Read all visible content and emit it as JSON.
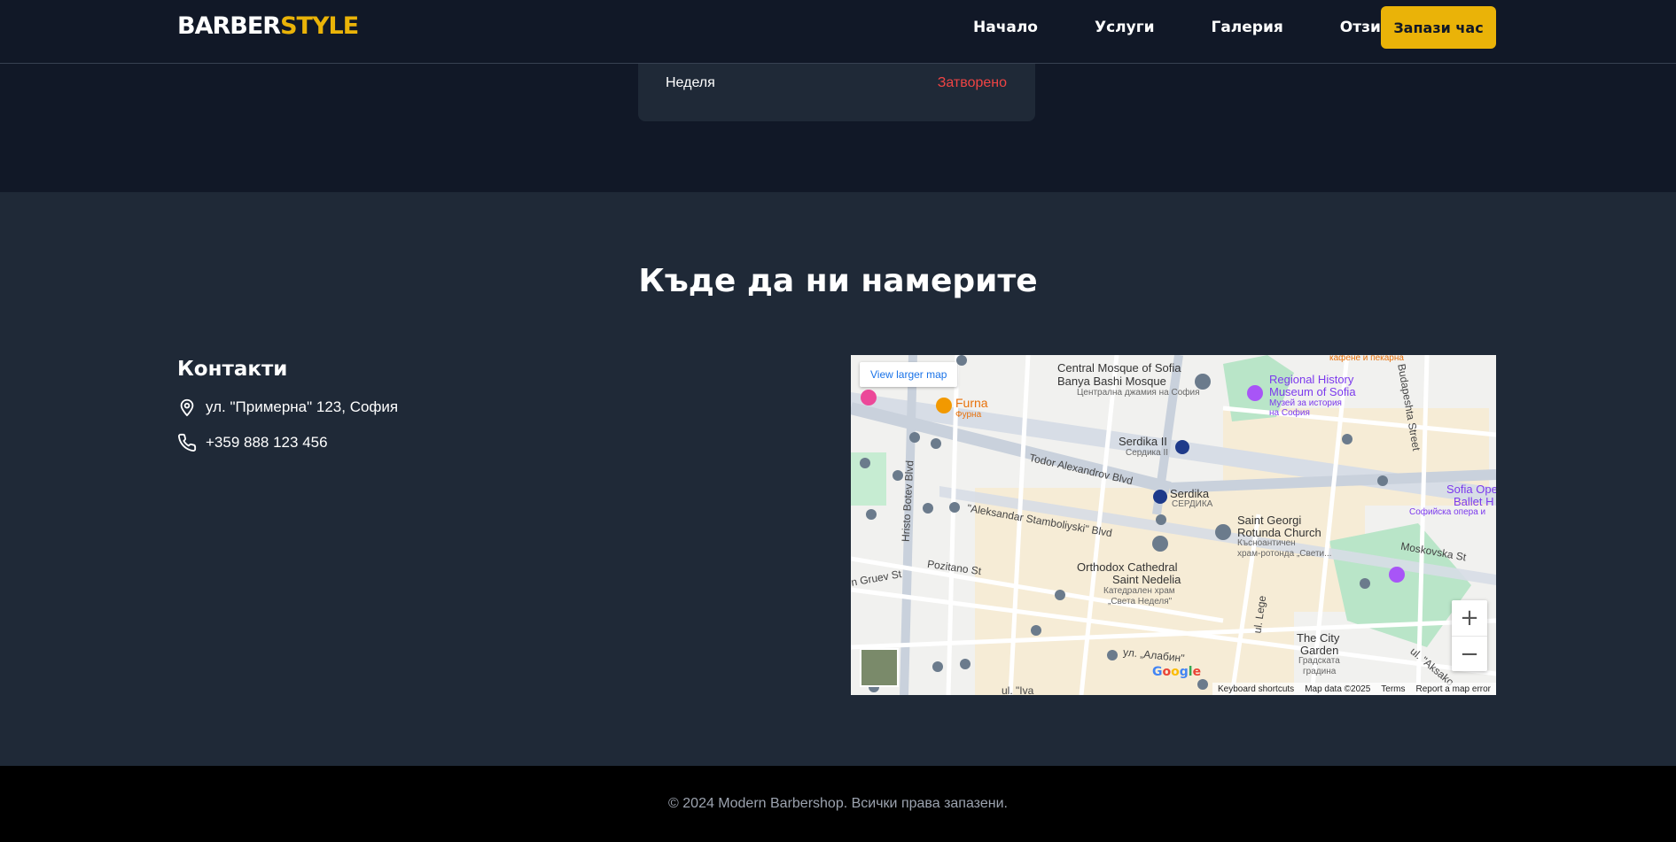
{
  "brand": {
    "part1": "BARBER",
    "part2": "STYLE",
    "accent_color": "#eab308"
  },
  "nav": {
    "items": [
      {
        "label": "Начало"
      },
      {
        "label": "Услуги"
      },
      {
        "label": "Галерия"
      },
      {
        "label": "Отзиви"
      }
    ],
    "cta_label": "Запази час"
  },
  "hours": {
    "day": "Неделя",
    "status": "Затворено",
    "status_color": "#ef4444"
  },
  "location": {
    "title": "Къде да ни намерите",
    "contacts_heading": "Контакти",
    "address": "ул. \"Примерна\" 123, София",
    "phone": "+359 888 123 456",
    "address_icon": "map-pin-icon",
    "phone_icon": "phone-icon"
  },
  "map": {
    "larger_map_label": "View larger map",
    "zoom_in": "+",
    "zoom_out": "−",
    "google": "Google",
    "attribution": {
      "shortcuts": "Keyboard shortcuts",
      "data": "Map data ©2025",
      "terms": "Terms",
      "report": "Report a map error"
    },
    "labels": {
      "mosque": "Central Mosque of Sofia",
      "mosque2": "Banya Bashi Mosque",
      "mosque_bg": "Централна джамия на София",
      "furna": "Furna",
      "furna_bg": "Фурна",
      "museum": "Regional History",
      "museum2": "Museum of Sofia",
      "museum_bg": "Музей за история",
      "museum_bg2": "на София",
      "serdika2": "Serdika II",
      "serdika2_bg": "Сердика II",
      "serdika": "Serdika",
      "serdika_bg": "СЕРДИКА",
      "todor": "Todor Alexandrov Blvd",
      "stamboliyski": "\"Aleksandar Stamboliyski\" Blvd",
      "botev": "Hristo Botev Blvd",
      "rotunda": "Saint Georgi",
      "rotunda2": "Rotunda Church",
      "rotunda_bg": "Къснoантичен",
      "rotunda_bg2": "храм-ротонда „Свети...",
      "nedelia": "Orthodox Cathedral",
      "nedelia2": "Saint Nedelia",
      "nedelia_bg": "Катедрален храм",
      "nedelia_bg2": "„Света Неделя\"",
      "pozitano": "Pozitano St",
      "gruev": "n Gruev St",
      "budapeshta": "Budapeshta Street",
      "opera": "Sofia Ope",
      "opera2": "Ballet H",
      "opera_bg": "Софийска опера и",
      "moskovska": "Moskovska St",
      "citygarden": "The City",
      "citygarden2": "Garden",
      "citygarden_bg": "Градската",
      "citygarden_bg2": "градина",
      "alabin": "ул. „Алабин\"",
      "legé": "ul. Lege",
      "bakery": "кафене и пекарна",
      "ulica": "ul. \"Iva",
      "aksakov": "ul. \"Aksako"
    }
  },
  "footer": {
    "copyright": "© 2024 Modern Barbershop. Всички права запазени."
  }
}
